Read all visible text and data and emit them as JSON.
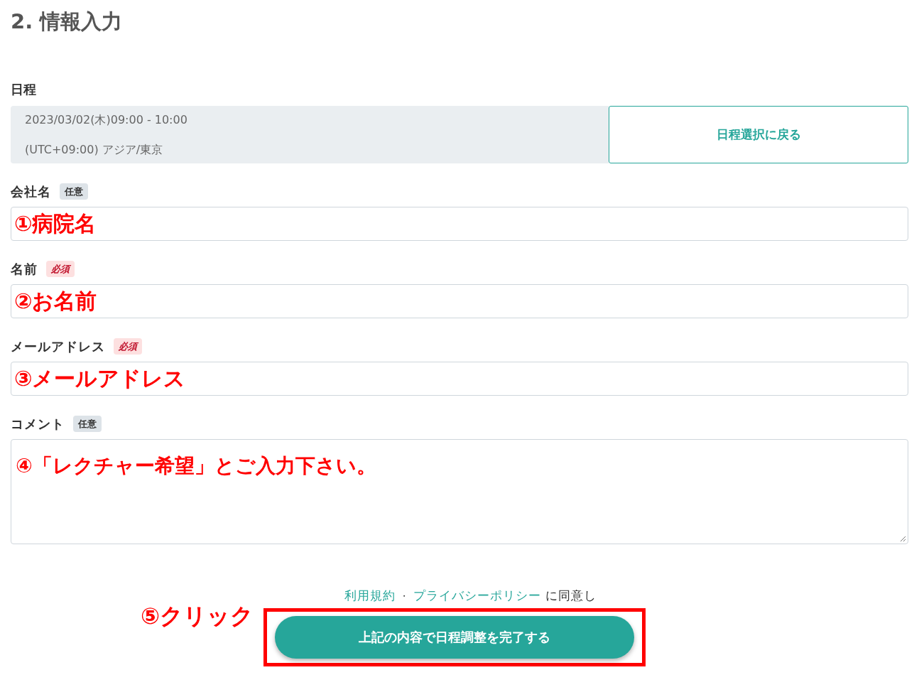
{
  "heading": "2. 情報入力",
  "schedule": {
    "label": "日程",
    "datetime": "2023/03/02(木)09:00 - 10:00",
    "timezone": "(UTC+09:00) アジア/東京",
    "back_button": "日程選択に戻る"
  },
  "fields": [
    {
      "label": "会社名",
      "badge": {
        "text": "任意",
        "kind": "optional"
      },
      "kind": "input",
      "annotation": "①病院名"
    },
    {
      "label": "名前",
      "badge": {
        "text": "必須",
        "kind": "required"
      },
      "kind": "input",
      "annotation": "②お名前"
    },
    {
      "label": "メールアドレス",
      "badge": {
        "text": "必須",
        "kind": "required"
      },
      "kind": "input",
      "annotation": "③メールアドレス"
    },
    {
      "label": "コメント",
      "badge": {
        "text": "任意",
        "kind": "optional"
      },
      "kind": "textarea",
      "annotation": "④「レクチャー希望」とご入力下さい。"
    }
  ],
  "agreement": {
    "terms_link": "利用規約",
    "separator": "・",
    "privacy_link": "プライバシーポリシー",
    "suffix": "に同意し"
  },
  "submit_button": "上記の内容で日程調整を完了する",
  "click_annotation": "⑤クリック"
}
